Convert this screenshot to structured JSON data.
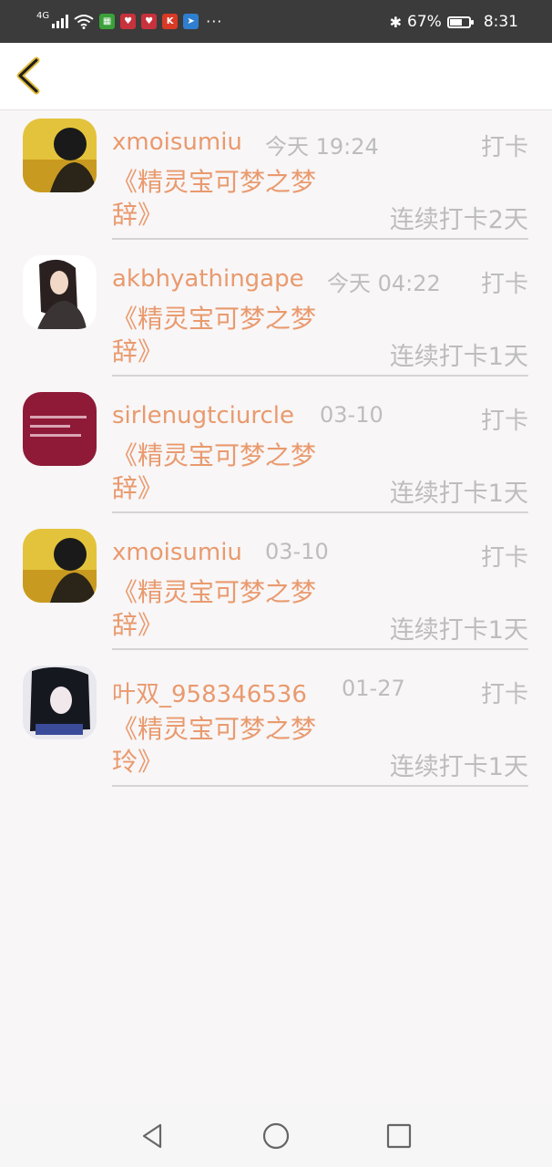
{
  "status_bar": {
    "network": "4G",
    "battery_pct": 0.67,
    "battery_text": "67%",
    "time": "8:31",
    "notification_icons": [
      "qq-icon",
      "heart-app-icon",
      "heart-app-icon",
      "kuaishou-icon",
      "mail-app-icon"
    ],
    "more": "···"
  },
  "header": {
    "back_icon": "chevron-left-icon"
  },
  "colors": {
    "accent": "#e99a6e",
    "muted": "#bdbdbd",
    "divider": "#d6d3d4",
    "background": "#f8f6f7"
  },
  "items": [
    {
      "name": "xmoisumiu",
      "time": "今天 19:24",
      "tag": "打卡",
      "book": "《精灵宝可梦之梦辞》",
      "streak": "连续打卡2天",
      "avatar": "avatar-boy-yellow"
    },
    {
      "name": "akbhyathingape",
      "time": "今天 04:22",
      "tag": "打卡",
      "book": "《精灵宝可梦之梦辞》",
      "streak": "连续打卡1天",
      "avatar": "avatar-girl"
    },
    {
      "name": "sirlenugtciurcle",
      "time": "03-10",
      "tag": "打卡",
      "book": "《精灵宝可梦之梦辞》",
      "streak": "连续打卡1天",
      "avatar": "avatar-red-text"
    },
    {
      "name": "xmoisumiu",
      "time": "03-10",
      "tag": "打卡",
      "book": "《精灵宝可梦之梦辞》",
      "streak": "连续打卡1天",
      "avatar": "avatar-boy-yellow"
    },
    {
      "name": "叶双_958346536",
      "time": "01-27",
      "tag": "打卡",
      "book": "《精灵宝可梦之梦玲》",
      "streak": "连续打卡1天",
      "avatar": "avatar-anime"
    }
  ],
  "nav_bar": {
    "back": "triangle-back-icon",
    "home": "circle-home-icon",
    "recents": "square-recents-icon"
  }
}
